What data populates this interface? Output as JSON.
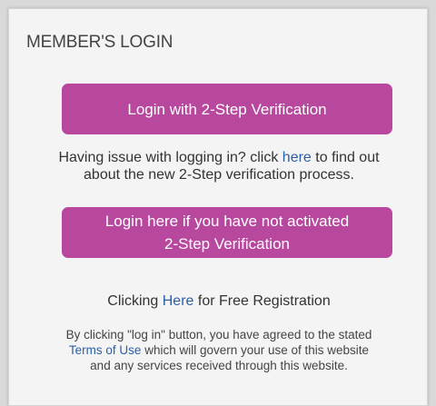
{
  "header": {
    "title": "MEMBER'S LOGIN"
  },
  "login_2step_button": {
    "label": "Login with 2-Step Verification"
  },
  "help": {
    "before_link": "Having issue with logging in? click ",
    "link_text": "here",
    "after_link_line1": " to find out",
    "line2": "about the new 2-Step verification process."
  },
  "activate_button": {
    "line1": "Login here if you have not activated",
    "line2": "2-Step Verification"
  },
  "registration": {
    "before_link": "Clicking ",
    "link_text": "Here",
    "after_link": " for Free Registration"
  },
  "legal": {
    "line1": "By clicking \"log in\" button, you have agreed to the stated",
    "terms_link": "Terms of Use",
    "line2_rest": " which will govern your use of this website",
    "line3": "and any services received through this website."
  },
  "colors": {
    "button_bg": "#b8479e",
    "link": "#2b5fa8",
    "panel_bg": "#f4f4f4",
    "page_bg": "#d9d9d9"
  }
}
